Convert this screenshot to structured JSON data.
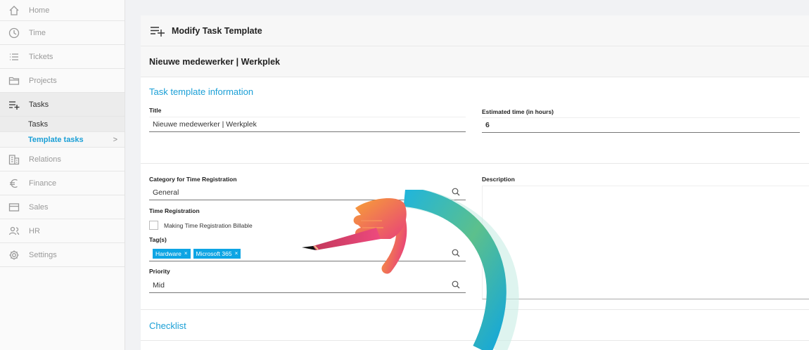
{
  "sidebar": {
    "items": [
      {
        "label": "Home",
        "icon": "home-icon"
      },
      {
        "label": "Time",
        "icon": "clock-icon"
      },
      {
        "label": "Tickets",
        "icon": "list-icon"
      },
      {
        "label": "Projects",
        "icon": "folder-icon"
      },
      {
        "label": "Tasks",
        "icon": "tasks-icon"
      },
      {
        "label": "Relations",
        "icon": "building-icon"
      },
      {
        "label": "Finance",
        "icon": "euro-icon"
      },
      {
        "label": "Sales",
        "icon": "card-icon"
      },
      {
        "label": "HR",
        "icon": "people-icon"
      },
      {
        "label": "Settings",
        "icon": "gear-icon"
      }
    ],
    "tasks_sub": {
      "tasks": "Tasks",
      "template_tasks": "Template tasks",
      "chevron": ">"
    }
  },
  "header": {
    "title": "Modify Task Template",
    "icon": "task-add-icon"
  },
  "subheader": {
    "title": "Nieuwe medewerker | Werkplek"
  },
  "form": {
    "section_title": "Task template information",
    "title_label": "Title",
    "title_value": "Nieuwe medewerker | Werkplek",
    "estimated_label": "Estimated time (in hours)",
    "estimated_value": "6",
    "category_label": "Category for Time Registration",
    "category_value": "General",
    "description_label": "Description",
    "time_reg_label": "Time Registration",
    "billable_label": "Making Time Registration Billable",
    "tags_label": "Tag(s)",
    "tags": [
      "Hardware",
      "Microsoft 365"
    ],
    "tag_remove": "×",
    "priority_label": "Priority",
    "priority_value": "Mid"
  },
  "checklist": {
    "title": "Checklist"
  },
  "colors": {
    "accent": "#1a9fd6",
    "tag": "#0ea5e4"
  }
}
